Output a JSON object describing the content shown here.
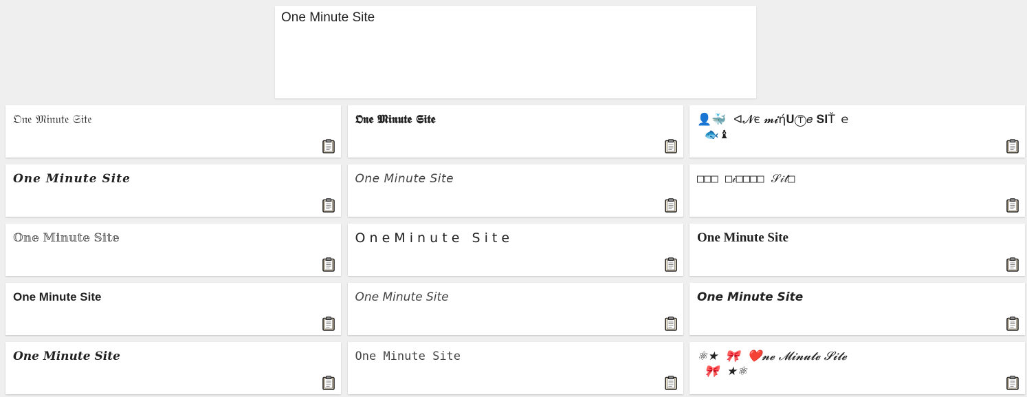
{
  "input": {
    "value": "One Minute Site"
  },
  "results": [
    {
      "text": "𝔒𝔫𝔢 𝔐𝔦𝔫𝔲𝔱𝔢 𝔖𝔦𝔱𝔢"
    },
    {
      "text": "𝕺𝖓𝖊 𝕸𝖎𝖓𝖚𝖙𝖊 𝕾𝖎𝖙𝖊"
    },
    {
      "text": "👤🐳  ᐊ𝓝є 𝓶𝓲ή𝐔Ⓣ𝑒 𝐒𝐈Ť ｅ\n  🐟♝"
    },
    {
      "text": "𝑶𝒏𝒆 𝑴𝒊𝒏𝒖𝒕𝒆 𝑺𝒊𝒕𝒆"
    },
    {
      "text": "𝘖𝘯𝘦 𝘔𝘪𝘯𝘶𝘵𝘦 𝘚𝘪𝘵𝘦"
    },
    {
      "text": "□□□ □𝒾□□□□ 𝒮𝒾𝓉□"
    },
    {
      "text": "𝕆𝕟𝕖 𝕄𝕚𝕟𝕦𝕥𝕖 𝕊𝕚𝕥𝕖"
    },
    {
      "text": "O n e M i n u t e   S i t e"
    },
    {
      "text": "One Minute Site"
    },
    {
      "text": "One Minute Site"
    },
    {
      "text": "One Minute Site"
    },
    {
      "text": "One Minute Site"
    },
    {
      "text": "One Minute Site"
    },
    {
      "text": "𝙾𝚗𝚎 𝙼𝚒𝚗𝚞𝚝𝚎 𝚂𝚒𝚝𝚎"
    },
    {
      "text": "⚛★  🎀  ❤️𝓷𝓮 𝓜𝓲𝓷𝓾𝓽𝓮 𝓢𝓲𝓽𝓮\n  🎀  ★⚛"
    }
  ],
  "icons": {
    "copy": "clipboard-icon"
  },
  "colors": {
    "background": "#efefef",
    "card": "#ffffff",
    "text": "#222222"
  }
}
